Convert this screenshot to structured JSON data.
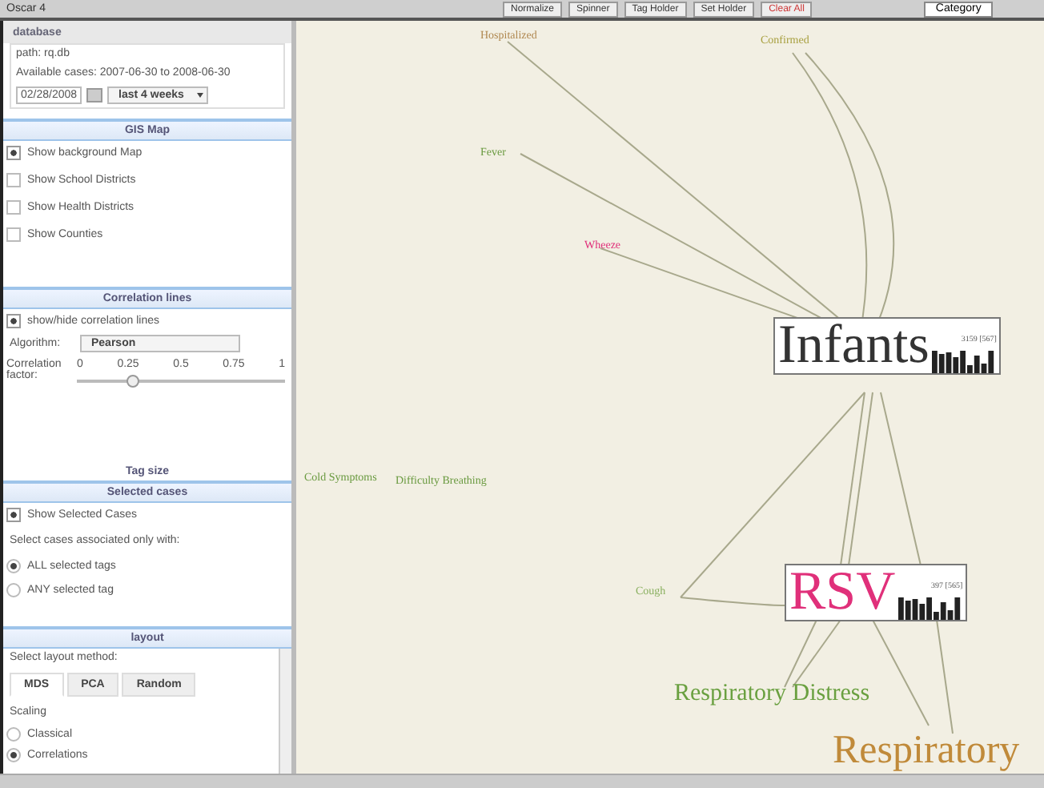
{
  "window": {
    "title": "Oscar 4"
  },
  "toolbar": {
    "buttons": [
      {
        "label": "Normalize",
        "kind": "normal"
      },
      {
        "label": "Spinner",
        "kind": "normal"
      },
      {
        "label": "Tag Holder",
        "kind": "normal"
      },
      {
        "label": "Set Holder",
        "kind": "normal"
      },
      {
        "label": "Clear All",
        "kind": "danger"
      }
    ],
    "dropdown": "Category"
  },
  "database": {
    "title": "database",
    "path": "path:  rq.db",
    "available": "Available cases: 2007-06-30 to 2008-06-30",
    "date": "02/28/2008",
    "range": "last 4 weeks"
  },
  "gis_map": {
    "title": "GIS Map",
    "options": [
      {
        "label": "Show background Map",
        "checked": true
      },
      {
        "label": "Show School Districts",
        "checked": false
      },
      {
        "label": "Show Health Districts",
        "checked": false
      },
      {
        "label": "Show Counties",
        "checked": false
      }
    ]
  },
  "correlation": {
    "title": "Correlation lines",
    "toggle": {
      "label": "show/hide correlation lines",
      "checked": true
    },
    "algorithm_label": "Algorithm:",
    "algorithm": "Pearson",
    "factor_label": "Correlation factor:",
    "ticks": [
      "0",
      "0.25",
      "0.5",
      "0.75",
      "1"
    ],
    "level": 0.27
  },
  "tag_size": {
    "title": "Tag size"
  },
  "selected_cases": {
    "title": "Selected cases",
    "toggle": {
      "label": "Show Selected Cases",
      "checked": true
    },
    "prompt": "Select cases associated only with:",
    "options": [
      {
        "label": "ALL selected tags",
        "selected": true
      },
      {
        "label": "ANY selected tag",
        "selected": false
      }
    ]
  },
  "layout": {
    "title": "layout",
    "prompt": "Select layout method:",
    "tabs": [
      {
        "label": "MDS",
        "selected": true
      },
      {
        "label": "PCA",
        "selected": false
      },
      {
        "label": "Random",
        "selected": false
      }
    ],
    "scaling_label": "Scaling",
    "scaling": [
      {
        "label": "Classical",
        "selected": false
      },
      {
        "label": "Correlations",
        "selected": true
      }
    ]
  },
  "canvas": {
    "tags": [
      {
        "text": "Infants",
        "kind": "major",
        "count": "3159 [567]",
        "color": "#333333"
      },
      {
        "text": "RSV",
        "kind": "major",
        "count": "397 [565]",
        "color": "#e0307a"
      },
      {
        "text": "Respiratory Distress",
        "kind": "medium",
        "color": "#6aa040"
      },
      {
        "text": "Respiratory",
        "kind": "large",
        "color": "#c08a3a"
      },
      {
        "text": "Hospitalized",
        "kind": "minor",
        "color": "#b08850"
      },
      {
        "text": "Confirmed",
        "kind": "minor",
        "color": "#a8a040"
      },
      {
        "text": "Fever",
        "kind": "minor",
        "color": "#6a9a40"
      },
      {
        "text": "Wheeze",
        "kind": "minor",
        "color": "#e0307a"
      },
      {
        "text": "Cough",
        "kind": "minor",
        "color": "#8ab060"
      },
      {
        "text": "Cold Symptoms",
        "kind": "minor",
        "color": "#6a9a40"
      },
      {
        "text": "Difficulty Breathing",
        "kind": "minor",
        "color": "#6a9a40"
      }
    ]
  }
}
